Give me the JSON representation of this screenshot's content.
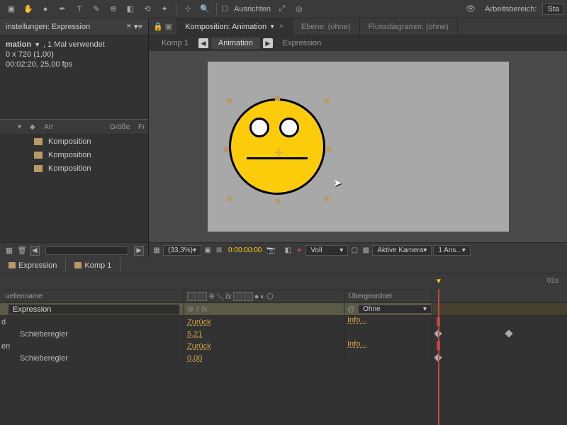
{
  "toolbar": {
    "align_label": "Ausrichten",
    "workspace_label": "Arbeitsbereich:",
    "workspace_value": "Sta"
  },
  "project_panel": {
    "header": "instellungen: Expression",
    "comp_name": "mation",
    "usage": ", 1 Mal verwendet",
    "dims": "0 x 720 (1,00)",
    "duration": "00:02:20, 25,00 fps",
    "col_art": "Art",
    "col_size": "Größe",
    "col_fr": "Fr",
    "items": [
      {
        "label": "Komposition"
      },
      {
        "label": "Komposition"
      },
      {
        "label": "Komposition"
      }
    ]
  },
  "viewer": {
    "tab_comp_label": "Komposition: Animation",
    "tab_layer": "Ebene: (ohne)",
    "tab_flow": "Flussdiagramm: (ohne)",
    "bc_comp": "Komp 1",
    "bc_anim": "Animation",
    "bc_expr": "Expression",
    "zoom": "(33,3%)",
    "timecode": "0:00:00:00",
    "res": "Voll",
    "camera": "Aktive Kamera",
    "views": "1 Ans..."
  },
  "timeline": {
    "tab1": "Expression",
    "tab2": "Komp 1",
    "col_source": "uellenname",
    "col_parent": "Übergeordnet",
    "layer_name": "Expression",
    "parent_value": "Ohne",
    "ruler_1s": "01s",
    "rows": [
      {
        "label": "d",
        "link": "Zurück",
        "info": "Info..."
      },
      {
        "label": "Schieberegler",
        "link": "5,21",
        "info": ""
      },
      {
        "label": "en",
        "link": "Zurück",
        "info": "Info..."
      },
      {
        "label": "Schieberegler",
        "link": "0,00",
        "info": ""
      }
    ]
  }
}
